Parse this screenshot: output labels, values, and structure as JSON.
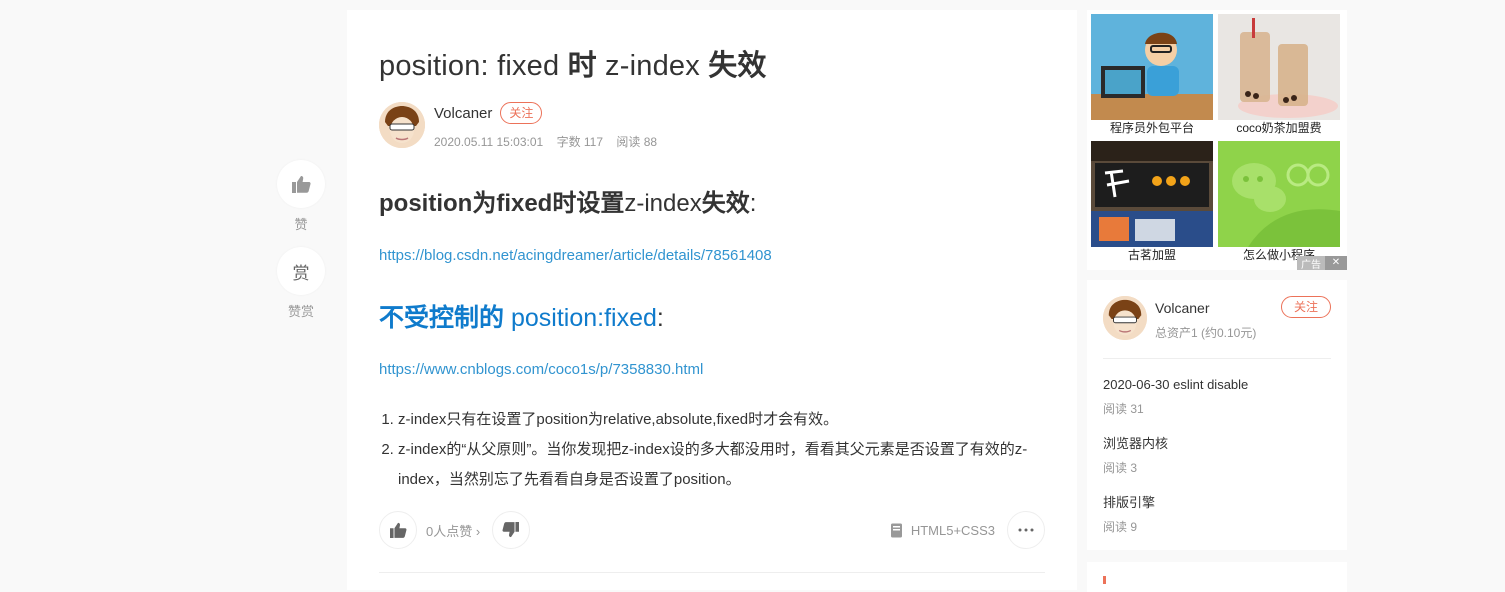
{
  "article": {
    "title_prefix": "position: fixed ",
    "title_bold_1": "时",
    "title_middle": " z-index ",
    "title_bold_2": "失效",
    "author": {
      "name": "Volcaner",
      "follow_label": "关注",
      "date": "2020.05.11 15:03:01",
      "word_count": "字数 117",
      "reads": "阅读 88"
    },
    "section1": {
      "part_a": "position",
      "part_b": "为",
      "part_c": "fixed",
      "part_d": "时设置",
      "part_e": "z-index",
      "part_f": "失效",
      "part_g": ":"
    },
    "link1": "https://blog.csdn.net/acingdreamer/article/details/78561408",
    "section2": {
      "bold_text": "不受控制的",
      "rest_text": " position:fixed",
      "colon": ":"
    },
    "link2": "https://www.cnblogs.com/coco1s/p/7358830.html",
    "notes": [
      "z-index只有在设置了position为relative,absolute,fixed时才会有效。",
      "z-index的“从父原则”。当你发现把z-index设的多大都没用时，看看其父元素是否设置了有效的z-index，当然别忘了先看看自身是否设置了position。"
    ],
    "bottom": {
      "like_count": "0人点赞",
      "like_chevron": "›",
      "tag": "HTML5+CSS3"
    }
  },
  "side": {
    "like_label": "赞",
    "reward_glyph": "赏",
    "reward_label": "赞赏"
  },
  "ads": {
    "items": [
      {
        "caption": "程序员外包平台"
      },
      {
        "caption": "coco奶茶加盟费"
      },
      {
        "caption": "古茗加盟"
      },
      {
        "caption": "怎么做小程序"
      }
    ],
    "ad_label": "广告",
    "close": "✕"
  },
  "author_card": {
    "name": "Volcaner",
    "asset": "总资产1 (约0.10元)",
    "follow_label": "关注",
    "posts": [
      {
        "title": "2020-06-30 eslint disable",
        "reads": "阅读 31"
      },
      {
        "title": "浏览器内核",
        "reads": "阅读 3"
      },
      {
        "title": "排版引擎",
        "reads": "阅读 9"
      }
    ]
  },
  "icons": {
    "like": "thumbs-up-icon",
    "dislike": "thumbs-down-icon",
    "tag": "notebook-icon",
    "more": "more-icon"
  },
  "colors": {
    "accent": "#ec7259",
    "link": "#3194d0",
    "heading_blue": "#0f7bcc"
  }
}
